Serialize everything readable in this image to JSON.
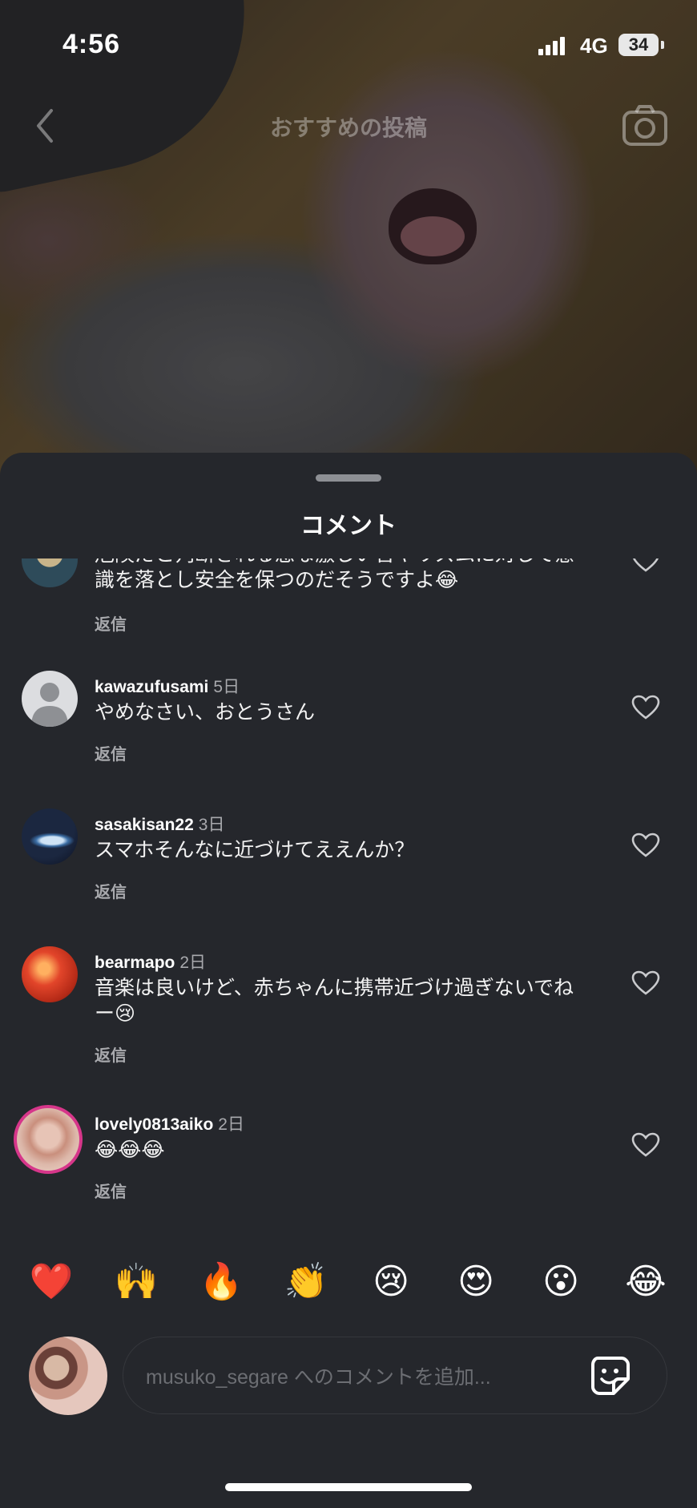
{
  "status_bar": {
    "time": "4:56",
    "network": "4G",
    "battery": "34"
  },
  "nav": {
    "title": "おすすめの投稿",
    "back_icon": "chevron-left-icon",
    "camera_icon": "camera-icon"
  },
  "sheet": {
    "title": "コメント"
  },
  "comments": [
    {
      "username": "",
      "ago": "",
      "text": "危険だと判断される急な激しい音やリズムに対して意識を落とし安全を保つのだそうですよ😂",
      "reply": "返信"
    },
    {
      "username": "kawazufusami",
      "ago": "5日",
      "text": "やめなさい、おとうさん",
      "reply": "返信"
    },
    {
      "username": "sasakisan22",
      "ago": "3日",
      "text": "スマホそんなに近づけてええんか？",
      "reply": "返信"
    },
    {
      "username": "bearmapo",
      "ago": "2日",
      "text": "音楽は良いけど、赤ちゃんに携帯近づけ過ぎないでねー😢",
      "reply": "返信"
    },
    {
      "username": "lovely0813aiko",
      "ago": "2日",
      "text": "😂😂😂",
      "reply": "返信"
    }
  ],
  "quick_reactions": [
    "❤️",
    "🙌",
    "🔥",
    "👏",
    "😢",
    "😍",
    "😮",
    "😂"
  ],
  "composer": {
    "placeholder": "musuko_segare へのコメントを追加...",
    "sticker_icon": "sticker-icon"
  },
  "colors": {
    "sheet_bg": "#25272c",
    "muted_text": "#a8a9ad",
    "placeholder": "#6c6e73"
  }
}
